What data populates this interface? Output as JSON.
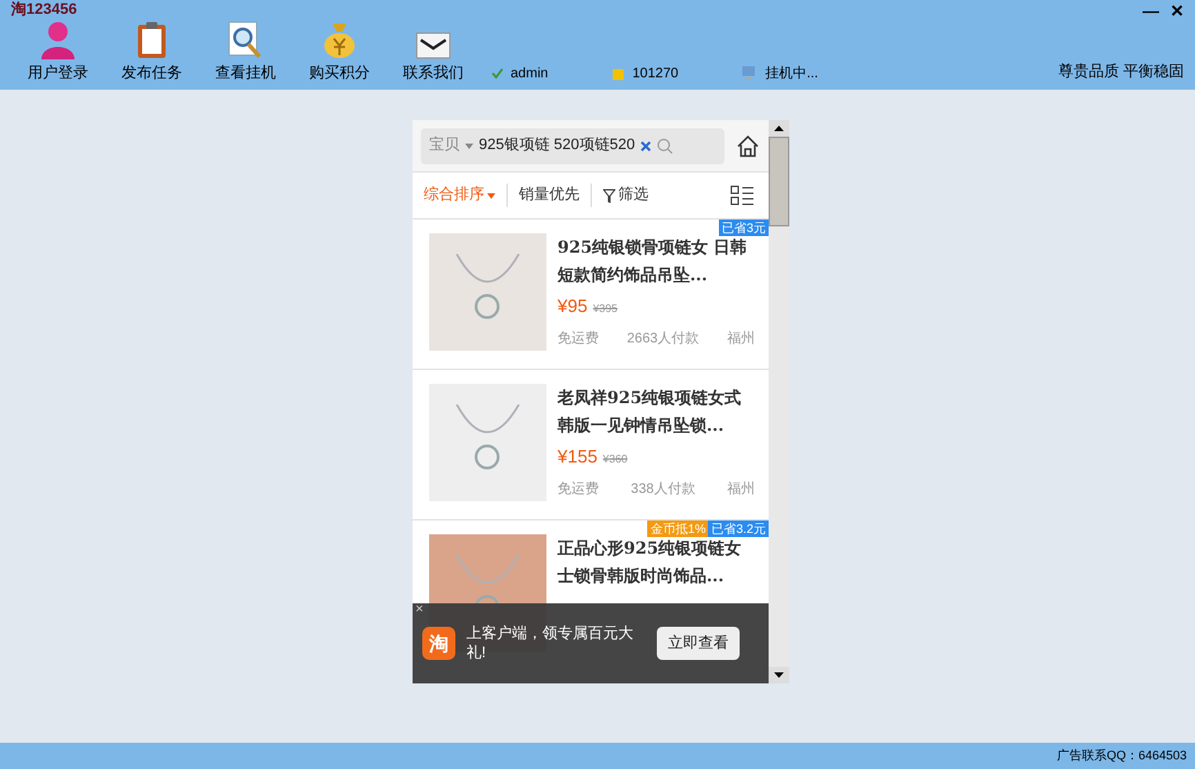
{
  "window": {
    "title": "淘123456",
    "controls": [
      "—",
      "✕"
    ]
  },
  "toolbar": [
    {
      "label": "用户登录",
      "kind": "user"
    },
    {
      "label": "发布任务",
      "kind": "clipboard"
    },
    {
      "label": "查看挂机",
      "kind": "magnifier"
    },
    {
      "label": "购买积分",
      "kind": "moneybag"
    },
    {
      "label": "联系我们",
      "kind": "envelope"
    }
  ],
  "status_items": [
    {
      "text": "admin",
      "kind": "check"
    },
    {
      "text": "101270",
      "kind": "coins"
    },
    {
      "text": "挂机中...",
      "kind": "computer"
    }
  ],
  "slogan": "尊贵品质 平衡稳固",
  "phone": {
    "search": {
      "scope": "宝贝",
      "value": "925银项链 520项链520"
    },
    "sort_tabs": [
      {
        "label": "综合排序",
        "selected": true,
        "kind": "dropdown"
      },
      {
        "label": "销量优先",
        "selected": false,
        "kind": "plain"
      },
      {
        "label": "筛选",
        "selected": false,
        "kind": "filter"
      }
    ],
    "products": [
      {
        "title": "925纯银锁骨项链女 日韩短款简约饰品吊坠...",
        "price": "¥95",
        "original_price": "¥395",
        "shipping": "免运费",
        "sales": "2663人付款",
        "location": "福州",
        "tags": [
          {
            "text": "已省3元",
            "color": "#2a8cf0"
          }
        ]
      },
      {
        "title": "老凤祥925纯银项链女式韩版一见钟情吊坠锁...",
        "price": "¥155",
        "original_price": "¥360",
        "shipping": "免运费",
        "sales": "338人付款",
        "location": "福州"
      },
      {
        "title": "正品心形925纯银项链女士锁骨韩版时尚饰品...",
        "tags": [
          {
            "text": "金币抵1%",
            "color": "#f39a12"
          },
          {
            "text": "已省3.2元",
            "color": "#2a8cf0"
          }
        ]
      }
    ],
    "banner": {
      "close": "×",
      "logo": "淘",
      "text": "上客户端，领专属百元大礼!",
      "button": "立即查看"
    }
  },
  "status_bar": {
    "right": "广告联系QQ：6464503"
  }
}
